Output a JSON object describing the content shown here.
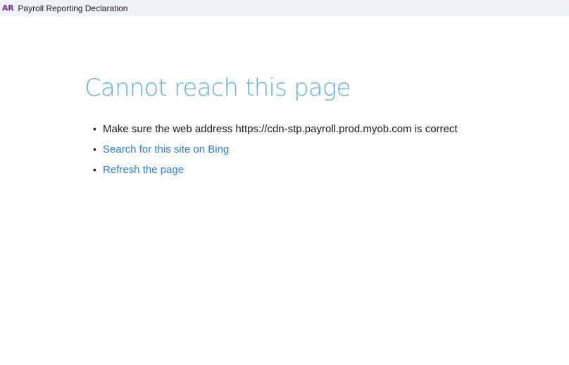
{
  "window": {
    "logo_text": "AR",
    "title": "Payroll Reporting Declaration"
  },
  "error_page": {
    "heading": "Cannot reach this page",
    "suggestions": [
      {
        "text": "Make sure the web address https://cdn-stp.payroll.prod.myob.com is correct",
        "is_link": false
      },
      {
        "text": "Search for this site on Bing",
        "is_link": true
      },
      {
        "text": "Refresh the page",
        "is_link": true
      }
    ]
  },
  "colors": {
    "heading": "#66aee6",
    "link": "#2f7dd1",
    "logo": "#7b2c91",
    "titlebar_bg": "#eef1f6"
  }
}
